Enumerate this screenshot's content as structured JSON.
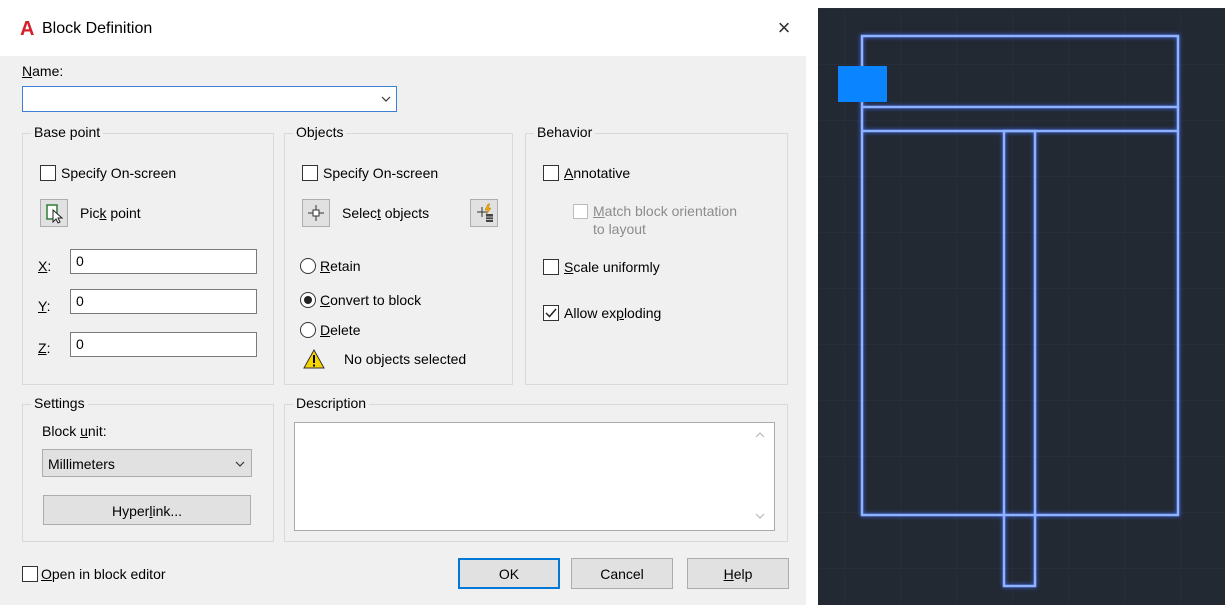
{
  "window": {
    "title": "Block Definition",
    "close_glyph": "×"
  },
  "name": {
    "label": "Name:",
    "value": ""
  },
  "base_point": {
    "legend": "Base point",
    "specify_onscreen": {
      "label": "Specify On-screen",
      "checked": false
    },
    "pick_point_label": "Pick point",
    "x": {
      "label": "X:",
      "value": "0"
    },
    "y": {
      "label": "Y:",
      "value": "0"
    },
    "z": {
      "label": "Z:",
      "value": "0"
    }
  },
  "objects": {
    "legend": "Objects",
    "specify_onscreen": {
      "label": "Specify On-screen",
      "checked": false
    },
    "select_objects_label": "Select objects",
    "retain": "Retain",
    "convert_to_block": "Convert to block",
    "delete": "Delete",
    "selected_option": "Convert to block",
    "status": "No objects selected"
  },
  "behavior": {
    "legend": "Behavior",
    "annotative": {
      "label": "Annotative",
      "checked": false
    },
    "match_orientation_line1": "Match block orientation",
    "match_orientation_line2": "to layout",
    "scale_uniformly": {
      "label": "Scale uniformly",
      "checked": false
    },
    "allow_exploding": {
      "label": "Allow exploding",
      "checked": true
    }
  },
  "settings": {
    "legend": "Settings",
    "block_unit_label": "Block unit:",
    "block_unit_value": "Millimeters",
    "hyperlink_label": "Hyperlink..."
  },
  "description": {
    "legend": "Description",
    "value": ""
  },
  "footer": {
    "open_in_block_editor": {
      "label": "Open in block editor",
      "checked": false
    },
    "ok": "OK",
    "cancel": "Cancel",
    "help": "Help"
  },
  "colors": {
    "title_icon": "#d4202a",
    "cad_background": "#222933",
    "cad_lines": "#5b8cff",
    "cad_grip": "#0a84ff"
  },
  "icons": [
    "autocad-logo-icon",
    "close-icon",
    "pick-point-icon",
    "select-objects-icon",
    "quick-select-icon",
    "warning-icon",
    "chevron-down-icon",
    "checkmark-icon"
  ]
}
